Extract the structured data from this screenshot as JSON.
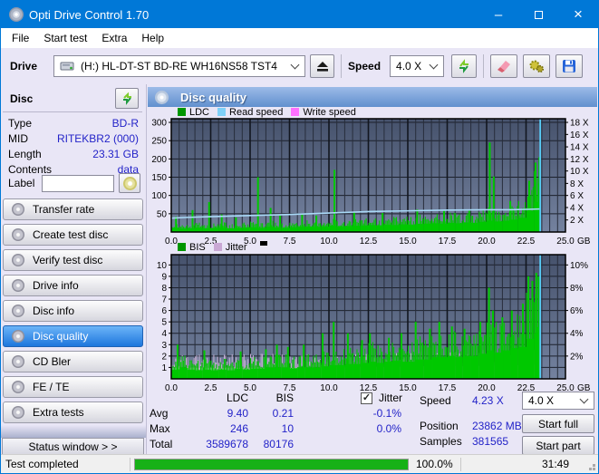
{
  "window": {
    "title": "Opti Drive Control 1.70"
  },
  "icons": {
    "minimize_glyph": "–",
    "close_glyph": "×"
  },
  "menu": {
    "items": [
      "File",
      "Start test",
      "Extra",
      "Help"
    ]
  },
  "toolbar": {
    "drive_label": "Drive",
    "drive_value": "(H:)   HL-DT-ST BD-RE   WH16NS58 TST4",
    "speed_label": "Speed",
    "speed_value": "4.0 X",
    "icon_names": [
      "eject-icon",
      "refresh-arrows-icon",
      "erase-disc-icon",
      "settings-gears-icon",
      "save-disk-icon"
    ]
  },
  "sidebar": {
    "disc_header": "Disc",
    "info": [
      {
        "label": "Type",
        "value": "BD-R"
      },
      {
        "label": "MID",
        "value": "RITEKBR2 (000)"
      },
      {
        "label": "Length",
        "value": "23.31 GB"
      },
      {
        "label": "Contents",
        "value": "data"
      }
    ],
    "label_field": {
      "label": "Label",
      "value": ""
    },
    "buttons": [
      {
        "label": "Transfer rate",
        "active": false
      },
      {
        "label": "Create test disc",
        "active": false
      },
      {
        "label": "Verify test disc",
        "active": false
      },
      {
        "label": "Drive info",
        "active": false
      },
      {
        "label": "Disc info",
        "active": false
      },
      {
        "label": "Disc quality",
        "active": true
      },
      {
        "label": "CD Bler",
        "active": false
      },
      {
        "label": "FE / TE",
        "active": false
      },
      {
        "label": "Extra tests",
        "active": false
      }
    ],
    "status_window_button": "Status window > >"
  },
  "panel": {
    "title": "Disc quality",
    "legend1": [
      {
        "label": "LDC",
        "color": "#009600"
      },
      {
        "label": "Read speed",
        "color": "#7fd0f7"
      },
      {
        "label": "Write speed",
        "color": "#ff70ff"
      }
    ],
    "legend2": [
      {
        "label": "BIS",
        "color": "#009600"
      },
      {
        "label": "Jitter",
        "color": "#c9a8d4"
      }
    ],
    "stats": {
      "col_headers": [
        "LDC",
        "BIS"
      ],
      "jitter_checkbox": {
        "label": "Jitter",
        "checked": true,
        "glyph": "✓"
      },
      "rows": [
        {
          "label": "Avg",
          "ldc": "9.40",
          "bis": "0.21",
          "jitter": "-0.1%"
        },
        {
          "label": "Max",
          "ldc": "246",
          "bis": "10",
          "jitter": "0.0%"
        },
        {
          "label": "Total",
          "ldc": "3589678",
          "bis": "80176",
          "jitter": ""
        }
      ],
      "speed_label": "Speed",
      "speed_value": "4.23 X",
      "position_label": "Position",
      "position_value": "23862 MB",
      "samples_label": "Samples",
      "samples_value": "381565",
      "speed_select": "4.0 X",
      "buttons": [
        "Start full",
        "Start part"
      ]
    }
  },
  "chart_data": [
    {
      "type": "bar",
      "title": "LDC errors vs disc position with read speed overlay",
      "legend": [
        "LDC",
        "Read speed",
        "Write speed"
      ],
      "xlim": [
        0,
        25
      ],
      "x_ticks": [
        0,
        2.5,
        5,
        7.5,
        10,
        12.5,
        15,
        17.5,
        20,
        22.5,
        25
      ],
      "x_unit": "GB",
      "ylim": [
        0,
        310
      ],
      "y_ticks_left": [
        50,
        100,
        150,
        200,
        250,
        300
      ],
      "y_ticks_right": [
        {
          "label": "2 X",
          "v": 33
        },
        {
          "label": "4 X",
          "v": 67
        },
        {
          "label": "6 X",
          "v": 100
        },
        {
          "label": "8 X",
          "v": 133
        },
        {
          "label": "10 X",
          "v": 167
        },
        {
          "label": "12 X",
          "v": 200
        },
        {
          "label": "14 X",
          "v": 233
        },
        {
          "label": "16 X",
          "v": 267
        },
        {
          "label": "18 X",
          "v": 300
        }
      ],
      "data_end": 23.4,
      "bin_width": 0.5,
      "grid": true,
      "series": [
        {
          "name": "LDC",
          "kind": "noise",
          "color": "#00c800",
          "floor": [
            22,
            18,
            20,
            24,
            20,
            22,
            25,
            20,
            22,
            24,
            26,
            22,
            28,
            24,
            22,
            26,
            28,
            30,
            28,
            30,
            34,
            30,
            32,
            34,
            36,
            38,
            36,
            40,
            38,
            42,
            40,
            44,
            46,
            48,
            46,
            50,
            48,
            52,
            50,
            56,
            62,
            58,
            62,
            68,
            78,
            115,
            165
          ]
        },
        {
          "name": "LDC-peaks",
          "kind": "peaks",
          "color": "#00c800",
          "points": [
            [
              0.3,
              42
            ],
            [
              1.35,
              60
            ],
            [
              2.4,
              82
            ],
            [
              3.2,
              48
            ],
            [
              4.1,
              40
            ],
            [
              5.5,
              150
            ],
            [
              6.3,
              66
            ],
            [
              6.9,
              45
            ],
            [
              8.3,
              50
            ],
            [
              9.2,
              45
            ],
            [
              10.35,
              170
            ],
            [
              11.6,
              55
            ],
            [
              13.4,
              52
            ],
            [
              15.6,
              62
            ],
            [
              17.3,
              58
            ],
            [
              18.9,
              60
            ],
            [
              20.2,
              245
            ],
            [
              20.45,
              152
            ],
            [
              21.5,
              85
            ],
            [
              22.7,
              140
            ],
            [
              23.1,
              190
            ],
            [
              23.35,
              205
            ]
          ]
        },
        {
          "name": "Read speed",
          "kind": "line",
          "color": "#a9d9f7",
          "x": [
            0,
            1,
            2.5,
            5,
            7.5,
            10,
            12.5,
            15,
            17.5,
            20,
            21.5,
            22.5,
            23.4
          ],
          "y": [
            38,
            40,
            42,
            45,
            48,
            52,
            56,
            58,
            60,
            61,
            61,
            62,
            63
          ]
        },
        {
          "name": "read-end-spike",
          "kind": "vline",
          "color": "#58cdf8",
          "x": 23.4,
          "top": 310
        }
      ]
    },
    {
      "type": "bar",
      "title": "BIS errors vs disc position with jitter overlay",
      "legend": [
        "BIS",
        "Jitter"
      ],
      "xlim": [
        0,
        25
      ],
      "x_ticks": [
        0,
        2.5,
        5,
        7.5,
        10,
        12.5,
        15,
        17.5,
        20,
        22.5,
        25
      ],
      "x_unit": "GB",
      "ylim": [
        0,
        10.9
      ],
      "y_ticks_left": [
        1,
        2,
        3,
        4,
        5,
        6,
        7,
        8,
        9,
        10
      ],
      "y_ticks_right": [
        {
          "label": "2%",
          "v": 2
        },
        {
          "label": "4%",
          "v": 4
        },
        {
          "label": "6%",
          "v": 6
        },
        {
          "label": "8%",
          "v": 8
        },
        {
          "label": "10%",
          "v": 10
        }
      ],
      "data_end": 23.4,
      "bin_width": 0.5,
      "grid": true,
      "series": [
        {
          "name": "Jitter",
          "kind": "noise",
          "color": "#c3aed1",
          "floor": [
            2,
            2,
            2,
            2,
            2,
            2,
            2,
            2,
            2,
            2,
            2,
            2,
            2,
            2,
            2,
            2,
            2,
            2,
            2,
            2,
            2,
            2,
            2.1,
            2.1,
            2.1,
            2.1,
            2.1,
            2.1,
            2.1,
            2.1,
            2.2,
            2.2,
            2.2,
            2.2,
            2.2,
            2.2,
            2.2,
            2.2,
            2.3,
            2.3,
            2.3,
            2.3,
            2.3,
            2.4,
            2.4,
            2.5,
            2.5
          ]
        },
        {
          "name": "BIS",
          "kind": "noise",
          "color": "#00c800",
          "floor": [
            1.6,
            2.0,
            1.6,
            1.5,
            1.6,
            1.5,
            1.6,
            1.5,
            1.8,
            1.6,
            1.8,
            1.8,
            2.0,
            2.0,
            2.0,
            1.8,
            2.0,
            2.0,
            2.0,
            2.2,
            2.4,
            2.4,
            2.6,
            2.6,
            2.8,
            3.0,
            2.8,
            3.0,
            3.2,
            3.0,
            3.0,
            3.4,
            3.4,
            3.8,
            3.8,
            4.0,
            3.8,
            4.0,
            4.0,
            4.4,
            5.0,
            4.6,
            5.0,
            5.4,
            5.6,
            7.0,
            8.0
          ]
        },
        {
          "name": "BIS-peaks",
          "kind": "peaks",
          "color": "#00c800",
          "points": [
            [
              0.4,
              3
            ],
            [
              2.1,
              2.5
            ],
            [
              4.4,
              2.4
            ],
            [
              6.0,
              2.6
            ],
            [
              6.7,
              3
            ],
            [
              7.4,
              2.8
            ],
            [
              8.4,
              3
            ],
            [
              9.6,
              4
            ],
            [
              10.3,
              5
            ],
            [
              11.2,
              4
            ],
            [
              12.1,
              3.4
            ],
            [
              12.6,
              4
            ],
            [
              13.8,
              3.6
            ],
            [
              14.6,
              4
            ],
            [
              15.5,
              5
            ],
            [
              16.4,
              4.4
            ],
            [
              17.0,
              5
            ],
            [
              17.8,
              4.6
            ],
            [
              18.6,
              4.4
            ],
            [
              19.6,
              5
            ],
            [
              20.15,
              8
            ],
            [
              20.4,
              6
            ],
            [
              21.0,
              5.4
            ],
            [
              21.6,
              6
            ],
            [
              22.3,
              6.6
            ],
            [
              22.65,
              9
            ],
            [
              22.9,
              8.6
            ],
            [
              23.15,
              9.3
            ],
            [
              23.3,
              9.0
            ]
          ]
        },
        {
          "name": "read-end-spike",
          "kind": "vline",
          "color": "#58cdf8",
          "x": 23.4,
          "top": 10.9
        }
      ]
    }
  ],
  "statusbar": {
    "text": "Test completed",
    "progress_fraction": 1.0,
    "progress_color": "#17b117",
    "progress_pct": "100.0%",
    "time": "31:49"
  }
}
